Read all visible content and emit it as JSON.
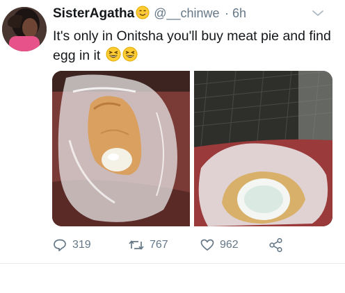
{
  "tweet": {
    "display_name": "SisterAgatha",
    "handle": "@__chinwe",
    "time": "· 6h",
    "text": "It's only in Onitsha you'll buy meat pie and find egg in it",
    "name_emoji": "smiling-face-emoji",
    "text_emojis": [
      "grinning-squinting-face-emoji",
      "grinning-squinting-face-emoji"
    ]
  },
  "actions": {
    "reply_count": "319",
    "retweet_count": "767",
    "like_count": "962"
  },
  "colors": {
    "text": "#14171a",
    "secondary": "#657786",
    "divider": "#e6ecf0"
  },
  "icons": [
    "reply-icon",
    "retweet-icon",
    "like-icon",
    "share-icon",
    "chevron-down-icon"
  ]
}
